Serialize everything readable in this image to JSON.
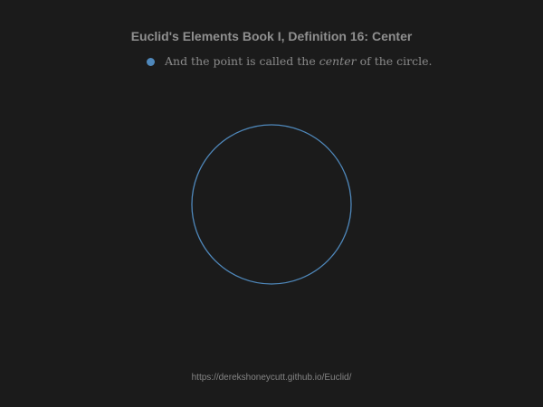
{
  "title": "Euclid's Elements Book I, Definition 16: Center",
  "bullet": {
    "before": "And the point is called the",
    "emphasis": "center",
    "after": "of the circle."
  },
  "footer": {
    "url": "https://derekshoneycutt.github.io/Euclid/"
  },
  "colors": {
    "background": "#1b1b1b",
    "accent": "#4f88bb",
    "text": "#8a8a8a"
  }
}
